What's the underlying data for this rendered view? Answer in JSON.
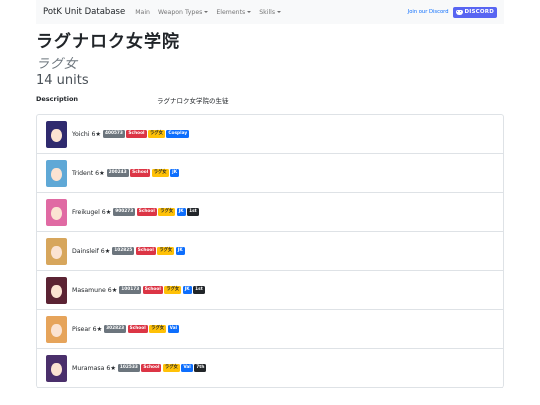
{
  "navbar": {
    "brand": "PotK Unit Database",
    "items": [
      {
        "label": "Main",
        "dropdown": false
      },
      {
        "label": "Weapon Types",
        "dropdown": true
      },
      {
        "label": "Elements",
        "dropdown": true
      },
      {
        "label": "Skills",
        "dropdown": true
      }
    ],
    "join_text": "Join our Discord",
    "discord_label": "DISCORD"
  },
  "page": {
    "title": "ラグナロク女学院",
    "subtitle": "ラグ女",
    "count": "14 units",
    "description_label": "Description",
    "description_value": "ラグナロク女学院の生徒"
  },
  "units": [
    {
      "name": "Yoichi 6★",
      "id": "400573",
      "tags": [
        "School",
        "ラグ女",
        "Cosplay"
      ],
      "hair": "#2f2a6e"
    },
    {
      "name": "Trident 6★",
      "id": "200243",
      "tags": [
        "School",
        "ラグ女",
        "JK"
      ],
      "hair": "#5fa8d6"
    },
    {
      "name": "Freikugel 6★",
      "id": "900273",
      "tags": [
        "School",
        "ラグ女",
        "JK",
        "1st"
      ],
      "hair": "#e06aa3"
    },
    {
      "name": "Dainsleif 6★",
      "id": "102825",
      "tags": [
        "School",
        "ラグ女",
        "JK"
      ],
      "hair": "#d7a65c"
    },
    {
      "name": "Masamune 6★",
      "id": "100173",
      "tags": [
        "School",
        "ラグ女",
        "JK",
        "1st"
      ],
      "hair": "#5b2333"
    },
    {
      "name": "Pisear 6★",
      "id": "302823",
      "tags": [
        "School",
        "ラグ女",
        "Val"
      ],
      "hair": "#e6a45b"
    },
    {
      "name": "Muramasa 6★",
      "id": "102533",
      "tags": [
        "School",
        "ラグ女",
        "Val",
        "7th"
      ],
      "hair": "#4a2f6b"
    }
  ],
  "colors": {
    "navbar_bg": "#f8f9fa",
    "school": "#dc3545",
    "ragu": "#ffc107",
    "blue": "#0d6efd",
    "dark": "#212529",
    "id": "#6c757d",
    "discord": "#5865f2"
  }
}
